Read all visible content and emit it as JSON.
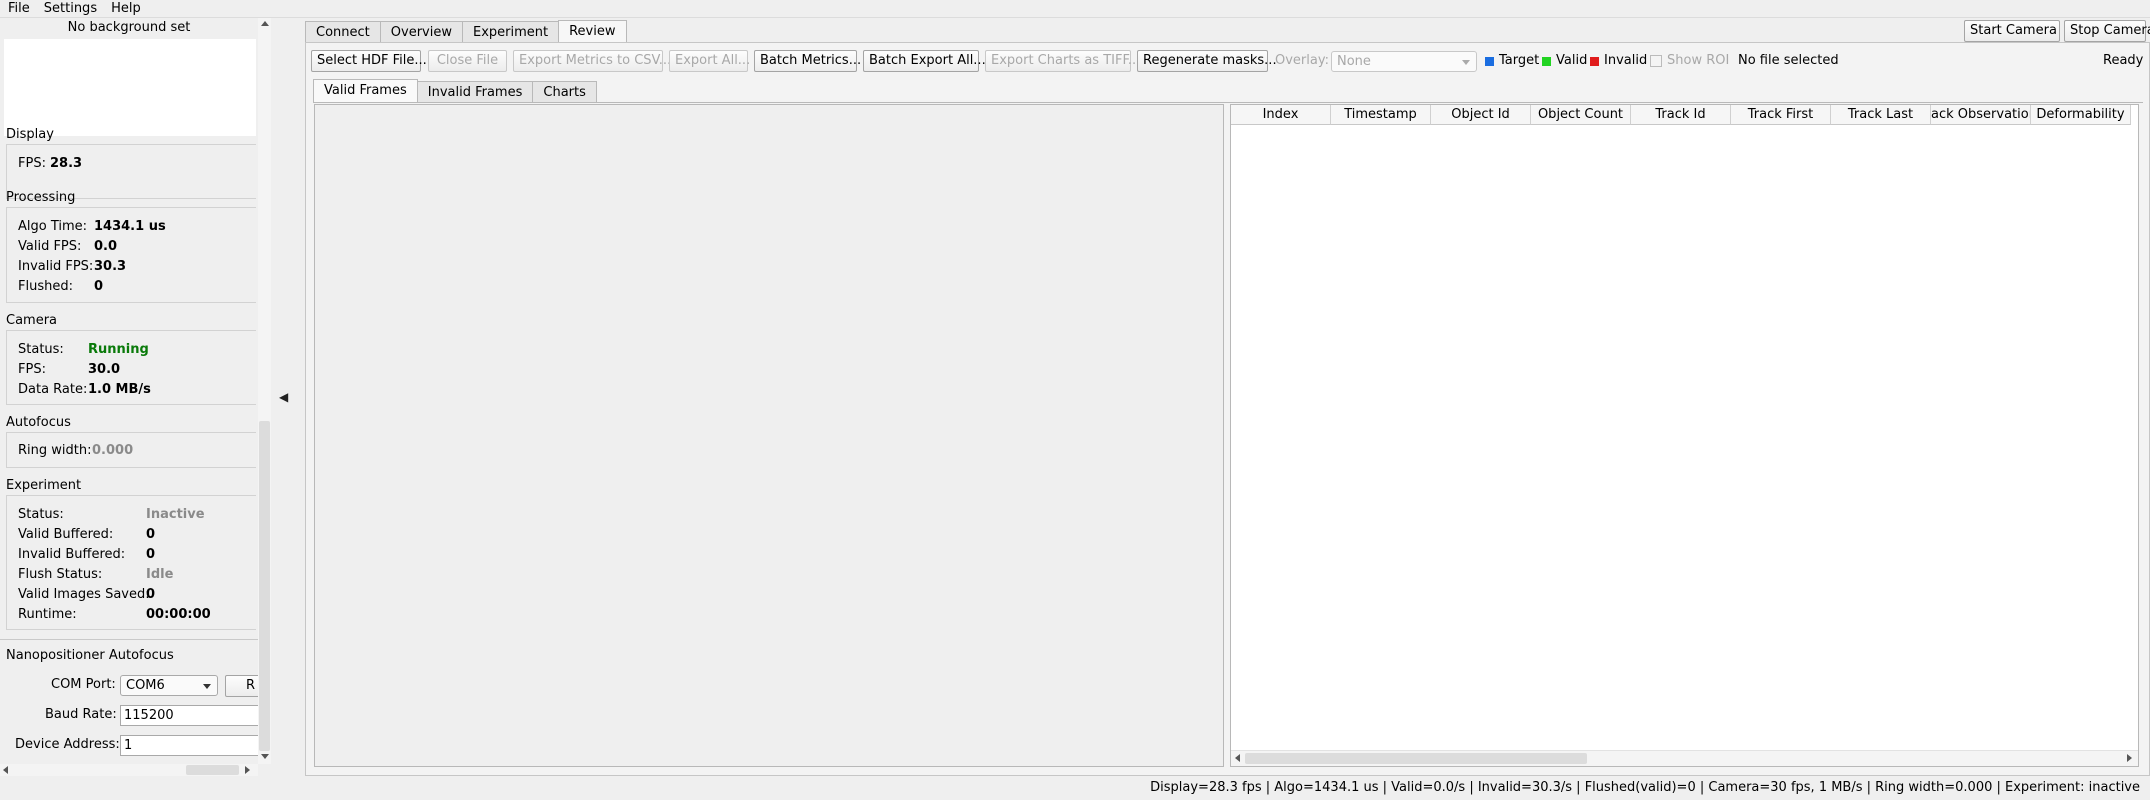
{
  "menu": [
    "File",
    "Settings",
    "Help"
  ],
  "left": {
    "background_label": "No background set",
    "display": {
      "title": "Display",
      "fps_label": "FPS:",
      "fps_value": "28.3"
    },
    "processing": {
      "title": "Processing",
      "algo_label": "Algo Time:",
      "algo_value": "1434.1 us",
      "valid_label": "Valid FPS:",
      "valid_value": "0.0",
      "invalid_label": "Invalid FPS:",
      "invalid_value": "30.3",
      "flushed_label": "Flushed:",
      "flushed_value": "0"
    },
    "camera": {
      "title": "Camera",
      "status_label": "Status:",
      "status_value": "Running",
      "fps_label": "FPS:",
      "fps_value": "30.0",
      "rate_label": "Data Rate:",
      "rate_value": "1.0 MB/s"
    },
    "autofocus": {
      "title": "Autofocus",
      "ring_label": "Ring width:",
      "ring_value": "0.000"
    },
    "experiment": {
      "title": "Experiment",
      "status_label": "Status:",
      "status_value": "Inactive",
      "vbuf_label": "Valid Buffered:",
      "vbuf_value": "0",
      "ibuf_label": "Invalid Buffered:",
      "ibuf_value": "0",
      "flush_label": "Flush Status:",
      "flush_value": "Idle",
      "saved_label": "Valid Images Saved:",
      "saved_value": "0",
      "runtime_label": "Runtime:",
      "runtime_value": "00:00:00"
    },
    "nano": {
      "title": "Nanopositioner Autofocus",
      "com_label": "COM Port:",
      "com_value": "COM6",
      "refresh_label": "R",
      "baud_label": "Baud Rate:",
      "baud_value": "115200",
      "addr_label": "Device Address:",
      "addr_value": "1"
    },
    "collapse_glyph": "◀"
  },
  "tabs": [
    "Connect",
    "Overview",
    "Experiment",
    "Review"
  ],
  "camera_buttons": {
    "start": "Start Camera",
    "stop": "Stop Camera"
  },
  "toolbar": {
    "select_hdf": "Select HDF File...",
    "close_file": "Close File",
    "export_csv": "Export Metrics to CSV...",
    "export_all": "Export All...",
    "batch_metrics": "Batch Metrics...",
    "batch_export": "Batch Export All...",
    "export_tiff": "Export Charts as TIFF...",
    "regen_masks": "Regenerate masks...",
    "overlay_label": "Overlay:",
    "overlay_value": "None",
    "legend_target": "Target",
    "legend_valid": "Valid",
    "legend_invalid": "Invalid",
    "show_roi": "Show ROI",
    "file_status": "No file selected",
    "ready": "Ready"
  },
  "legend_colors": {
    "target": "#1a6de0",
    "valid": "#22d322",
    "invalid": "#e01c1c"
  },
  "subtabs": [
    "Valid Frames",
    "Invalid Frames",
    "Charts"
  ],
  "table": {
    "columns": [
      "Index",
      "Timestamp",
      "Object Id",
      "Object Count",
      "Track Id",
      "Track First",
      "Track Last",
      "ack Observation",
      "Deformability"
    ]
  },
  "statusbar": "Display=28.3 fps | Algo=1434.1 us | Valid=0.0/s | Invalid=30.3/s | Flushed(valid)=0 | Camera=30 fps, 1 MB/s | Ring width=0.000 | Experiment: inactive"
}
